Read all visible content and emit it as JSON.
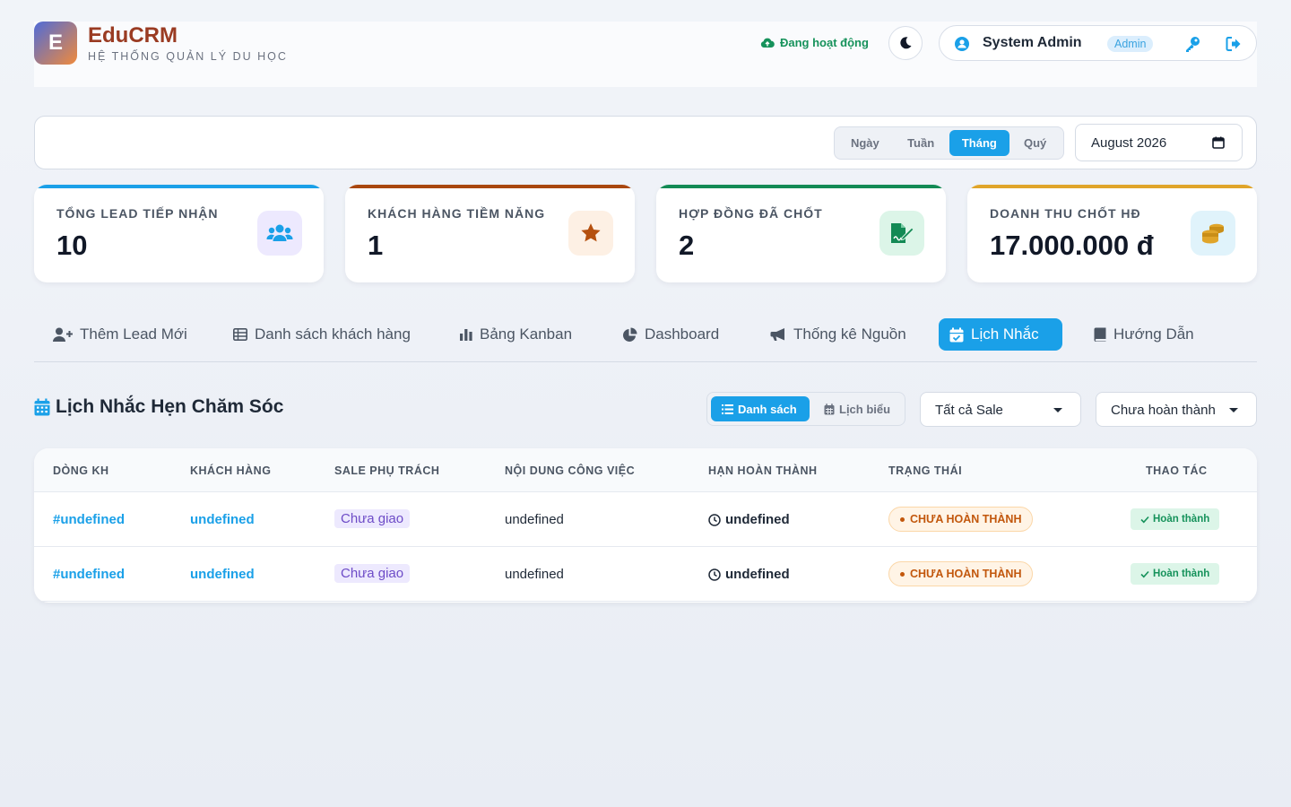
{
  "header": {
    "logo_letter": "E",
    "brand": "EduCRM",
    "subtitle": "HỆ THỐNG QUẢN LÝ DU HỌC",
    "status": "Đang hoạt động",
    "user_name": "System Admin",
    "user_role": "Admin"
  },
  "filter": {
    "periods": [
      "Ngày",
      "Tuần",
      "Tháng",
      "Quý"
    ],
    "active_period": "Tháng",
    "date_value": "August 2026"
  },
  "stats": [
    {
      "label": "TỔNG LEAD TIẾP NHẬN",
      "value": "10",
      "icon": "users-icon",
      "color": "#1aa0e8"
    },
    {
      "label": "KHÁCH HÀNG TIỀM NĂNG",
      "value": "1",
      "icon": "star-icon",
      "color": "#a9470f"
    },
    {
      "label": "HỢP ĐỒNG ĐÃ CHỐT",
      "value": "2",
      "icon": "contract-sign-icon",
      "color": "#138a55"
    },
    {
      "label": "DOANH THU CHỐT HĐ",
      "value": "17.000.000 đ",
      "icon": "coins-icon",
      "color": "#e0a52a"
    }
  ],
  "tabs": [
    {
      "label": "Thêm Lead Mới",
      "icon": "user-plus-icon"
    },
    {
      "label": "Danh sách khách hàng",
      "icon": "table-list-icon"
    },
    {
      "label": "Bảng Kanban",
      "icon": "bar-chart-icon"
    },
    {
      "label": "Dashboard",
      "icon": "pie-chart-icon"
    },
    {
      "label": "Thống kê Nguồn",
      "icon": "megaphone-icon"
    },
    {
      "label": "Lịch Nhắc",
      "icon": "calendar-check-icon"
    },
    {
      "label": "Hướng Dẫn",
      "icon": "book-icon"
    }
  ],
  "active_tab": "Lịch Nhắc",
  "section": {
    "title": "Lịch Nhắc Hẹn Chăm Sóc",
    "view_list": "Danh sách",
    "view_calendar": "Lịch biểu",
    "sale_filter": "Tất cả Sale",
    "status_filter": "Chưa hoàn thành"
  },
  "table": {
    "headers": [
      "DÒNG KH",
      "KHÁCH HÀNG",
      "SALE PHỤ TRÁCH",
      "NỘI DUNG CÔNG VIỆC",
      "HẠN HOÀN THÀNH",
      "TRẠNG THÁI",
      "THAO TÁC"
    ],
    "rows": [
      {
        "id": "#undefined",
        "customer": "undefined",
        "sale": "Chưa giao",
        "content": "undefined",
        "deadline": "undefined",
        "status": "CHƯA HOÀN THÀNH",
        "action": "Hoàn thành"
      },
      {
        "id": "#undefined",
        "customer": "undefined",
        "sale": "Chưa giao",
        "content": "undefined",
        "deadline": "undefined",
        "status": "CHƯA HOÀN THÀNH",
        "action": "Hoàn thành"
      }
    ]
  }
}
